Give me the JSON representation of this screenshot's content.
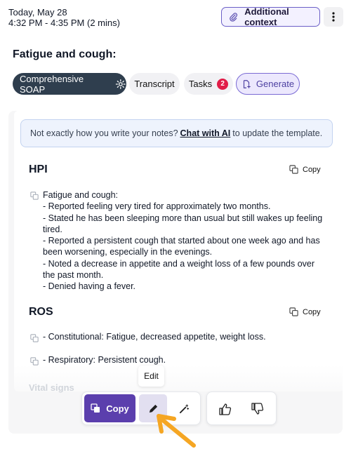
{
  "header": {
    "date": "Today, May 28",
    "time_range": "4:32 PM - 4:35 PM (2 mins)",
    "additional_context_label": "Additional context",
    "more_icon": "vertical-dots-icon"
  },
  "note_title": "Fatigue and cough:",
  "tabs": {
    "soap_label": "Comprehensive SOAP",
    "transcript_label": "Transcript",
    "tasks_label": "Tasks",
    "tasks_count": "2",
    "generate_label": "Generate"
  },
  "notice": {
    "prefix": "Not exactly how you write your notes?",
    "link": "Chat with AI",
    "suffix": "to update the template."
  },
  "sections": {
    "hpi": {
      "title": "HPI",
      "copy_label": "Copy",
      "lines": [
        "Fatigue and cough:",
        "- Reported feeling very tired for approximately two months.",
        "- Stated he has been sleeping more than usual but still wakes up feeling tired.",
        "- Reported a persistent cough that started about one week ago and has been worsening, especially in the evenings.",
        "- Noted a decrease in appetite and a weight loss of a few pounds over the past month.",
        "- Denied having a fever."
      ]
    },
    "ros": {
      "title": "ROS",
      "copy_label": "Copy",
      "items": [
        "- Constitutional: Fatigue, decreased appetite, weight loss.",
        "- Respiratory: Persistent cough."
      ]
    },
    "vital_signs": {
      "title": "Vital signs"
    }
  },
  "toolbar": {
    "copy_label": "Copy",
    "edit_tooltip": "Edit"
  },
  "colors": {
    "primary": "#5b3fad",
    "tab_active": "#2f3e4e",
    "badge": "#e11d48",
    "arrow": "#f5a623"
  }
}
